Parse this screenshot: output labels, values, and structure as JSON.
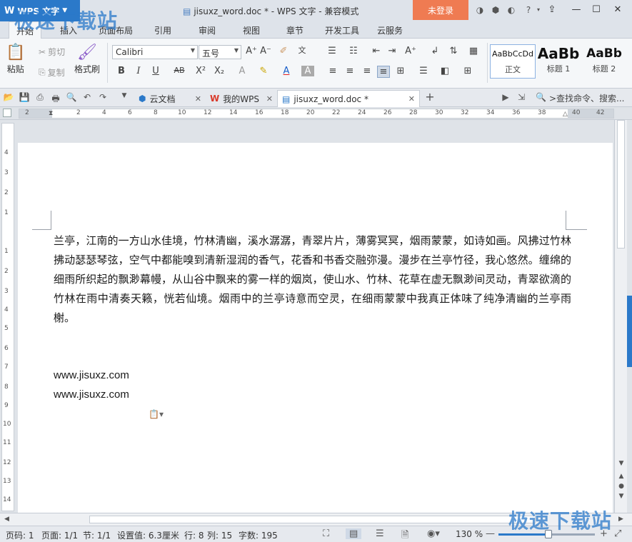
{
  "app": {
    "name": "WPS 文字",
    "login": "未登录"
  },
  "title": {
    "text": "jisuxz_word.doc * - WPS 文字 - 兼容模式"
  },
  "watermark": {
    "top_left": "极速下载站",
    "bottom_right": "极速下载站"
  },
  "ribbon_tabs": [
    "开始",
    "插入",
    "页面布局",
    "引用",
    "审阅",
    "视图",
    "章节",
    "开发工具",
    "云服务"
  ],
  "clipboard": {
    "paste": "粘贴",
    "cut": "剪切",
    "copy": "复制",
    "format_painter": "格式刷"
  },
  "font": {
    "name": "Calibri",
    "size": "五号"
  },
  "styles": [
    {
      "sample": "AaBbCcDd",
      "name": "正文"
    },
    {
      "sample": "AaBb",
      "name": "标题 1"
    },
    {
      "sample": "AaBb",
      "name": "标题 2"
    }
  ],
  "doc_tabs": [
    {
      "label": "云文档"
    },
    {
      "label": "我的WPS"
    },
    {
      "label": "jisuxz_word.doc *"
    }
  ],
  "search": {
    "placeholder": ">查找命令、搜索..."
  },
  "document": {
    "paragraph": "兰亭，江南的一方山水佳境，竹林清幽，溪水潺潺，青翠片片，薄雾冥冥，烟雨蒙蒙，如诗如画。风拂过竹林拂动瑟瑟琴弦，空气中都能嗅到清新湿润的香气，花香和书香交融弥漫。漫步在兰亭竹径，我心悠然。缠绵的细雨所织起的飘渺幕幔，从山谷中飘来的雾一样的烟岚，使山水、竹林、花草在虚无飘渺间灵动，青翠欲滴的竹林在雨中清奏天籁，恍若仙境。烟雨中的兰亭诗意而空灵，在细雨蒙蒙中我真正体味了纯净清幽的兰亭雨榭。",
    "url1": "www.jisuxz.com",
    "url2": "www.jisuxz.com"
  },
  "ruler": {
    "h": [
      "2",
      "2",
      "4",
      "6",
      "8",
      "10",
      "12",
      "14",
      "16",
      "18",
      "20",
      "22",
      "24",
      "26",
      "28",
      "30",
      "32",
      "34",
      "36",
      "38",
      "40",
      "42"
    ],
    "v": [
      "4",
      "3",
      "2",
      "1",
      "1",
      "2",
      "3",
      "4",
      "5",
      "6",
      "7",
      "8",
      "9",
      "10",
      "11",
      "12",
      "13",
      "14"
    ]
  },
  "status": {
    "page_num": "页码: 1",
    "pages": "页面: 1/1",
    "section": "节: 1/1",
    "setting": "设置值: 6.3厘米",
    "row": "行: 8",
    "col": "列: 15",
    "words": "字数: 195",
    "zoom": "130 %",
    "zoom_level": 0.52
  }
}
